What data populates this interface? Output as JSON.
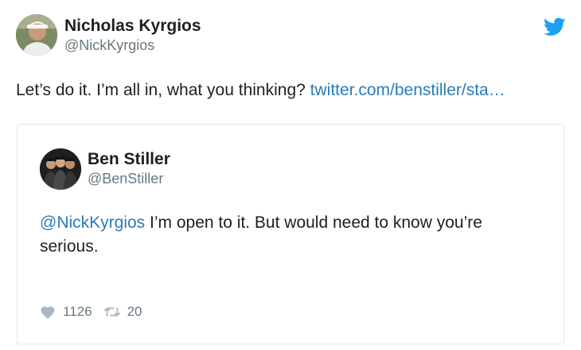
{
  "tweet": {
    "author": {
      "name": "Nicholas Kyrgios",
      "handle": "@NickKyrgios"
    },
    "text": "Let’s do it. I’m all in, what you thinking? ",
    "link": "twitter.com/benstiller/sta…",
    "brand_icon": "twitter-bird-icon",
    "colors": {
      "brand": "#1da1f2",
      "link": "#2b7bb9",
      "secondary_text": "#697882"
    }
  },
  "quoted_tweet": {
    "author": {
      "name": "Ben Stiller",
      "handle": "@BenStiller"
    },
    "mention": "@NickKyrgios",
    "text": " I’m open to it. But would need to know you’re serious.",
    "likes": "1126",
    "retweets": "20",
    "icons": {
      "like": "heart-icon",
      "retweet": "retweet-icon"
    }
  }
}
